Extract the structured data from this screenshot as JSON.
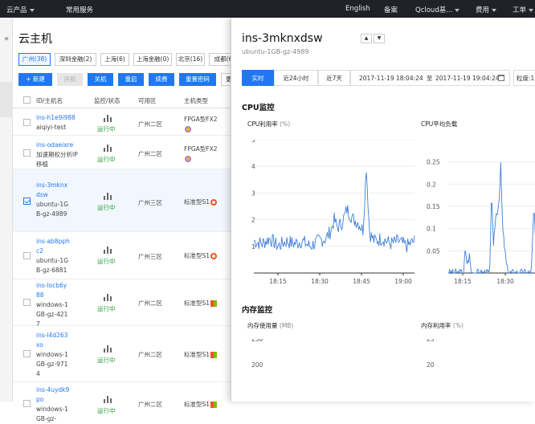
{
  "topbar": {
    "products": "云产品",
    "services": "常用服务",
    "english": "English",
    "beian": "备案",
    "account": "Qcloud基...",
    "fees": "费用",
    "tickets": "工单"
  },
  "sidebar": {
    "collapse_glyph": "«"
  },
  "page_title": "云主机",
  "regions": [
    "广州(38)",
    "深圳金融(2)",
    "上海(6)",
    "上海金融(0)",
    "北京(16)",
    "成都(6"
  ],
  "toolbar": {
    "new": "+ 新建",
    "start": "开机",
    "stop": "关机",
    "restart": "重启",
    "renew": "续费",
    "reset_pwd": "重置密码",
    "more": "更"
  },
  "table": {
    "headers": {
      "id": "ID/主机名",
      "monitor": "监控/状态",
      "zone": "可用区",
      "type": "主机类型"
    },
    "rows": [
      {
        "id": "ins-h1e9i988",
        "name": "aiqiyi-test",
        "status": "运行中",
        "zone": "广州二区",
        "type": "FPGA型FX2",
        "selected": false
      },
      {
        "id": "ins-odaeixre",
        "name": "加速期权分析IP移植",
        "status": "运行中",
        "zone": "广州二区",
        "type": "FPGA型FX2",
        "selected": false
      },
      {
        "id": "ins-3mknxdsw",
        "name": "ubuntu-1GB-gz-4989",
        "status": "运行中",
        "zone": "广州三区",
        "type": "标准型S1",
        "selected": true
      },
      {
        "id": "ins-ab8pphc2",
        "name": "ubuntu-1GB-gz-6881",
        "status": "运行中",
        "zone": "广州三区",
        "type": "标准型S1",
        "selected": false
      },
      {
        "id": "ins-locb6y88",
        "name": "windows-1GB-gz-4217",
        "status": "运行中",
        "zone": "广州二区",
        "type": "标准型S1",
        "selected": false
      },
      {
        "id": "ins-l4d263xo",
        "name": "windows-1GB-gz-9714",
        "status": "运行中",
        "zone": "广州二区",
        "type": "标准型S1",
        "selected": false
      },
      {
        "id": "ins-4uydk9po",
        "name": "windows-1GB-gz-",
        "status": "运行中",
        "zone": "广州二区",
        "type": "标准型S1",
        "selected": false
      }
    ]
  },
  "panel": {
    "title": "ins-3mknxdsw",
    "subtitle": "ubuntu-1GB-gz-4989",
    "nav_up": "▲",
    "nav_down": "▼",
    "time_tabs": [
      "实时",
      "近24小时",
      "近7天"
    ],
    "date_from": "2017-11-19 18:04:24",
    "date_sep": "至",
    "date_to": "2017-11-19 19:04:24",
    "granularity": "粒度:1",
    "cpu_section": "CPU监控",
    "mem_section": "内存监控",
    "cpu_util": {
      "label": "CPU利用率",
      "unit": "(%)"
    },
    "cpu_load": {
      "label": "CPU平均负载"
    },
    "mem_used": {
      "label": "内存使用量",
      "unit": "(MB)"
    },
    "mem_util": {
      "label": "内存利用率",
      "unit": "(%)"
    }
  },
  "chart_data": [
    {
      "type": "line",
      "title": "CPU利用率",
      "ylabel": "(%)",
      "ylim": [
        0,
        5
      ],
      "yticks": [
        1,
        2,
        3,
        4,
        5
      ],
      "xticks": [
        "18:15",
        "18:30",
        "18:45",
        "19:00"
      ],
      "color": "#3f7fdc",
      "x": [
        0,
        0.05,
        0.1,
        0.15,
        0.2,
        0.25,
        0.3,
        0.35,
        0.4,
        0.45,
        0.48,
        0.5,
        0.52,
        0.55,
        0.58,
        0.6,
        0.62,
        0.65,
        0.68,
        0.7,
        0.72,
        0.75,
        0.8,
        0.85,
        0.9,
        0.95,
        1
      ],
      "values": [
        1.2,
        1.1,
        1.3,
        1.0,
        1.2,
        1.1,
        1.2,
        1.0,
        1.2,
        1.3,
        1.6,
        2.0,
        1.7,
        1.9,
        2.4,
        2.2,
        2.0,
        1.9,
        1.6,
        4.0,
        1.5,
        1.2,
        1.3,
        1.1,
        1.2,
        1.0,
        1.2
      ]
    },
    {
      "type": "line",
      "title": "CPU平均负载",
      "ylim": [
        0,
        0.3
      ],
      "yticks": [
        0.05,
        0.1,
        0.15,
        0.2,
        0.25
      ],
      "xticks": [
        "18:15",
        "18:30",
        "18:45"
      ],
      "color": "#3f7fdc",
      "x": [
        0.22,
        0.23,
        0.26,
        0.28,
        0.3,
        0.35,
        0.5,
        0.51,
        0.52,
        0.54,
        0.56,
        0.6,
        0.62,
        0.64,
        0.68,
        0.7,
        0.75,
        0.8,
        0.85,
        0.9,
        0.95,
        0.98,
        1
      ],
      "values": [
        0,
        0.05,
        0.02,
        0.04,
        0,
        0,
        0,
        0.08,
        0.2,
        0.05,
        0.12,
        0.16,
        0.24,
        0.1,
        0.02,
        0,
        0,
        0,
        0,
        0,
        0,
        0.15,
        0.06
      ]
    },
    {
      "type": "line",
      "title": "内存使用量",
      "ylabel": "(MB)",
      "yticks": [
        200,
        250
      ]
    },
    {
      "type": "line",
      "title": "内存利用率",
      "ylabel": "(%)",
      "yticks": [
        20,
        25
      ]
    }
  ]
}
